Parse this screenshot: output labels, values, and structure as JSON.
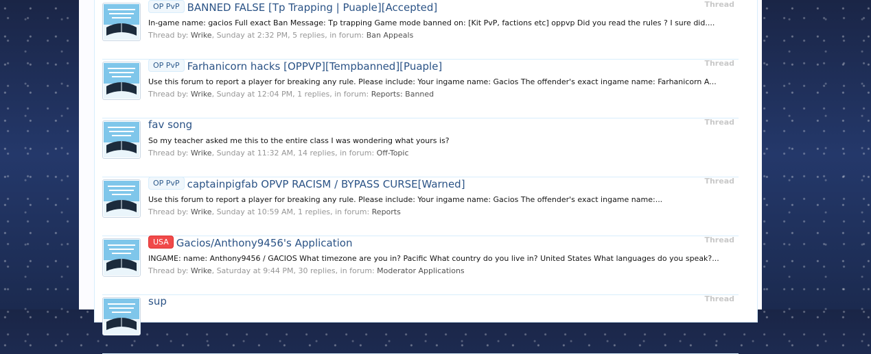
{
  "results": [
    {
      "prefix": "OP PvP",
      "prefix_color": "blue",
      "title": "BANNED FALSE [Tp Trapping | Puaple][Accepted]",
      "snippet": "In-game name: gacios Full exact Ban Message: Tp trapping Game mode banned on: [Kit PvP, factions etc] oppvp Did you read the rules ? I sure did....",
      "meta_prefix": "Thread by: ",
      "author": "Wrike",
      "date_replies": ", Sunday at 2:32 PM, 5 replies, in forum: ",
      "forum": "Ban Appeals",
      "type": "Thread"
    },
    {
      "prefix": "OP PvP",
      "prefix_color": "blue",
      "title": "Farhanicorn hacks [OPPVP][Tempbanned][Puaple]",
      "snippet": "Use this forum to report a player for breaking any rule. Please include: Your ingame name: Gacios The offender's exact ingame name: Farhanicorn A...",
      "meta_prefix": "Thread by: ",
      "author": "Wrike",
      "date_replies": ", Sunday at 12:04 PM, 1 replies, in forum: ",
      "forum": "Reports: Banned",
      "type": "Thread"
    },
    {
      "prefix": "",
      "prefix_color": "",
      "title": "fav song",
      "snippet": "So my teacher asked me this to the entire class I was wondering what yours is?",
      "meta_prefix": "Thread by: ",
      "author": "Wrike",
      "date_replies": ", Sunday at 11:32 AM, 14 replies, in forum: ",
      "forum": "Off-Topic",
      "type": "Thread"
    },
    {
      "prefix": "OP PvP",
      "prefix_color": "blue",
      "title": "captainpigfab OPVP RACISM / BYPASS CURSE[Warned]",
      "snippet": "Use this forum to report a player for breaking any rule. Please include: Your ingame name: Gacios The offender's exact ingame name:...",
      "meta_prefix": "Thread by: ",
      "author": "Wrike",
      "date_replies": ", Sunday at 10:59 AM, 1 replies, in forum: ",
      "forum": "Reports",
      "type": "Thread"
    },
    {
      "prefix": "USA",
      "prefix_color": "red",
      "title": "Gacios/Anthony9456's Application",
      "snippet": "INGAME: name: Anthony9456 / GACIOS What timezone are you in? Pacific What country do you live in? United States What languages do you speak?...",
      "meta_prefix": "Thread by: ",
      "author": "Wrike",
      "date_replies": ", Saturday at 9:44 PM, 30 replies, in forum: ",
      "forum": "Moderator Applications",
      "type": "Thread"
    },
    {
      "prefix": "",
      "prefix_color": "",
      "title": "sup",
      "snippet": "",
      "meta_prefix": "",
      "author": "",
      "date_replies": "",
      "forum": "",
      "type": "Thread"
    }
  ],
  "avatar_icon": "book-avatar-icon",
  "colors": {
    "link": "#2b5386",
    "accent_border": "#d7edfc",
    "red_prefix": "#f04a4a"
  }
}
